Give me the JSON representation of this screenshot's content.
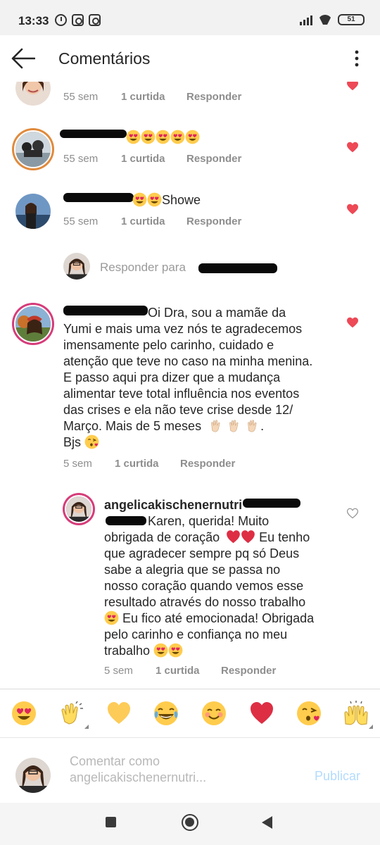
{
  "status_bar": {
    "time": "13:33",
    "battery": "51"
  },
  "header": {
    "title": "Comentários"
  },
  "comments": [
    {
      "time": "55 sem",
      "likes": "1 curtida",
      "reply": "Responder"
    },
    {
      "time": "55 sem",
      "likes": "1 curtida",
      "reply": "Responder"
    },
    {
      "text": "Showe",
      "time": "55 sem",
      "likes": "1 curtida",
      "reply": "Responder"
    },
    {
      "text_lines": [
        "Oi Dra, sou a mamãe da",
        "Yumi e mais uma vez nós te agradecemos",
        "imensamente pelo carinho, cuidado e",
        "atenção que teve no caso na minha menina.",
        "E passo aqui pra dizer que a mudança",
        "alimentar teve total influência nos eventos",
        "das crises e ela não teve crise desde 12/",
        "Março. Mais de 5 meses",
        "Bjs"
      ],
      "time": "5 sem",
      "likes": "1 curtida",
      "reply": "Responder"
    }
  ],
  "reply_to": {
    "label": "Responder para"
  },
  "reply": {
    "username": "angelicakischenernutri",
    "text_lines": [
      "Karen, querida! Muito",
      "obrigada de coração",
      "Eu tenho",
      "que agradecer sempre pq só Deus",
      "sabe a alegria que se passa no",
      "nosso coração quando vemos esse",
      "resultado através do nosso trabalho",
      "Eu fico até emocionada! Obrigada",
      "pelo carinho e confiança no meu",
      "trabalho"
    ],
    "time": "5 sem",
    "likes": "1 curtida",
    "reply": "Responder"
  },
  "emoji_bar": [
    "heart-eyes",
    "clapping-hands",
    "yellow-heart",
    "tears-of-joy",
    "smiling-face",
    "red-heart",
    "kissing-face",
    "raising-hands"
  ],
  "composer": {
    "placeholder_line1": "Comentar como",
    "placeholder_line2": "angelicakischenernutri...",
    "publish": "Publicar"
  },
  "colors": {
    "like_red": "#ed4956",
    "link_blue": "#b3dbff",
    "story_ring": "#d63c7a"
  }
}
